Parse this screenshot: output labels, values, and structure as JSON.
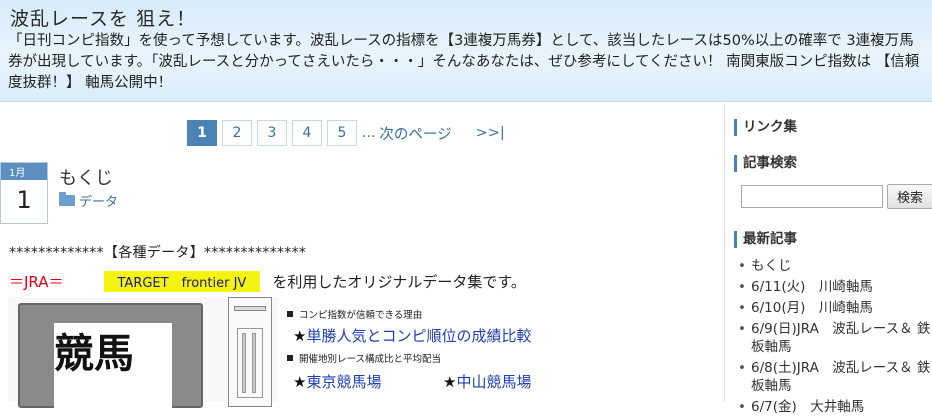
{
  "header": {
    "title": "波乱レースを 狙え！",
    "description": "「日刊コンピ指数」を使って予想しています。波乱レースの指標を【3連複万馬券】として、該当したレースは50%以上の確率で 3連複万馬券が出現しています。「波乱レースと分かってさえいたら・・・」そんなあなたは、ぜひ参考にしてください！ 南関東版コンピ指数は 【信頼度抜群！】 軸馬公開中！"
  },
  "pager": {
    "pages": [
      "1",
      "2",
      "3",
      "4",
      "5"
    ],
    "current": "1",
    "ellipsis": "...",
    "next": "次のページ",
    "last": ">>|"
  },
  "post": {
    "month": "1月",
    "day": "1",
    "title": "もくじ",
    "category": "データ",
    "line1": "*************【各種データ】**************",
    "jra_label": "＝JRA＝",
    "target_label": "TARGET　frontier JV",
    "jra_text": "を利用したオリジナルデータ集です。",
    "kanji": "競馬",
    "section1": "コンピ指数が信頼できる理由",
    "link1": "単勝人気とコンピ順位の成績比較",
    "section2": "開催地別レース構成比と平均配当",
    "link2": "東京競馬場",
    "link3": "中山競馬場",
    "star": "★"
  },
  "sidebar": {
    "links_heading": "リンク集",
    "search_heading": "記事検索",
    "search_button": "検索",
    "recent_heading": "最新記事",
    "recent": [
      "もくじ",
      "6/11(火)　川崎軸馬",
      "6/10(月)　川崎軸馬",
      "6/9(日)JRA　波乱レース＆ 鉄板軸馬",
      "6/8(土)JRA　波乱レース＆ 鉄板軸馬",
      "6/7(金)　大井軸馬"
    ]
  }
}
